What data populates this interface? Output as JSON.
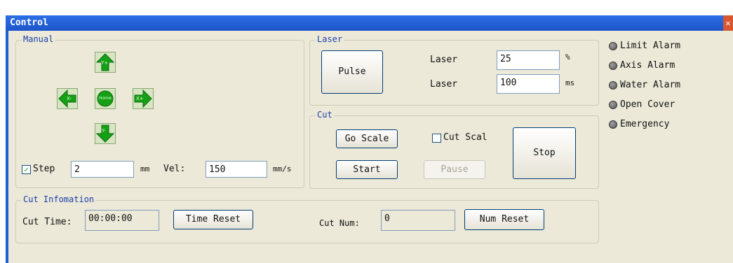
{
  "window": {
    "title": "Control",
    "close_glyph": "✕"
  },
  "manual": {
    "group_label": "Manual",
    "buttons": {
      "up": {
        "label": "Y+",
        "icon": "arrow-up-icon"
      },
      "down": {
        "label": "Y-",
        "icon": "arrow-down-icon"
      },
      "left": {
        "label": "X-",
        "icon": "arrow-left-icon"
      },
      "right": {
        "label": "X+",
        "icon": "arrow-right-icon"
      },
      "home": {
        "label": "Home",
        "icon": "home-icon"
      }
    },
    "step": {
      "checked": true,
      "check_glyph": "✓",
      "label": "Step",
      "value": "2",
      "unit": "mm"
    },
    "vel": {
      "label": "Vel:",
      "value": "150",
      "unit": "mm/s"
    }
  },
  "laser": {
    "group_label": "Laser",
    "pulse_label": "Pulse",
    "power": {
      "label": "Laser",
      "value": "25",
      "unit": "%"
    },
    "time": {
      "label": "Laser",
      "value": "100",
      "unit": "ms"
    }
  },
  "cut": {
    "group_label": "Cut",
    "go_scale_label": "Go Scale",
    "cut_scal": {
      "label": "Cut Scal",
      "checked": false
    },
    "start_label": "Start",
    "pause_label": "Pause",
    "stop_label": "Stop"
  },
  "alarms": {
    "items": [
      {
        "label": "Limit Alarm"
      },
      {
        "label": "Axis Alarm"
      },
      {
        "label": "Water Alarm"
      },
      {
        "label": "Open Cover"
      },
      {
        "label": "Emergency"
      }
    ]
  },
  "cut_info": {
    "group_label": "Cut Infomation",
    "time_label": "Cut Time:",
    "time_value": "00:00:00",
    "time_reset_label": "Time Reset",
    "num_label": "Cut Num:",
    "num_value": "0",
    "num_reset_label": "Num Reset"
  },
  "colors": {
    "title_bar": "#1f5fd6",
    "client_bg": "#ece9d8",
    "group_label": "#1c3faa",
    "arrow_green": "#15a015"
  }
}
